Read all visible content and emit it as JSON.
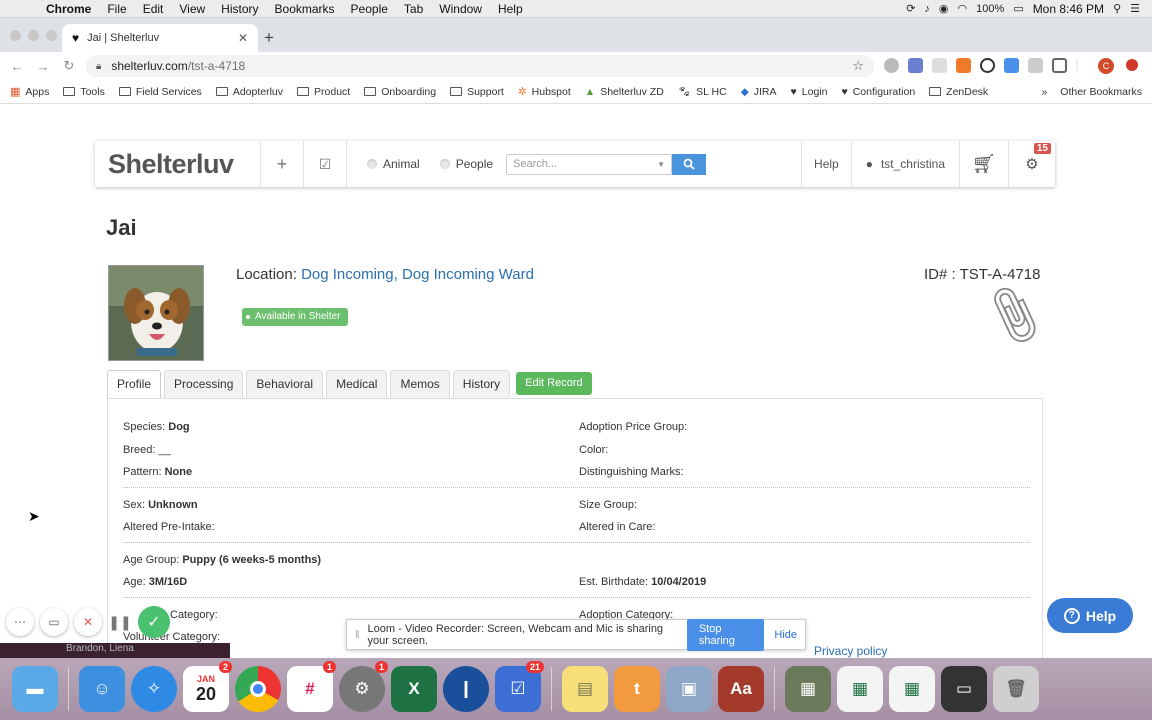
{
  "menubar": {
    "app": "Chrome",
    "items": [
      "File",
      "Edit",
      "View",
      "History",
      "Bookmarks",
      "People",
      "Tab",
      "Window",
      "Help"
    ],
    "battery": "100%",
    "clock": "Mon 8:46 PM"
  },
  "browser": {
    "tab_title": "Jai | Shelterluv",
    "url_host": "shelterluv.com",
    "url_path": "/tst-a-4718",
    "bookmarks": [
      "Apps",
      "Tools",
      "Field Services",
      "Adopterluv",
      "Product",
      "Onboarding",
      "Support",
      "Hubspot",
      "Shelterluv ZD",
      "SL HC",
      "JIRA",
      "Login",
      "Configuration",
      "ZenDesk"
    ],
    "bookmarks_more": "»",
    "other_bookmarks": "Other Bookmarks",
    "profile_initial": "C"
  },
  "header": {
    "logo": "Shelterluv",
    "radio_animal": "Animal",
    "radio_people": "People",
    "search_placeholder": "Search...",
    "help": "Help",
    "user": "tst_christina",
    "notifications": "15"
  },
  "animal": {
    "name": "Jai",
    "location_label": "Location:",
    "location_value": "Dog Incoming, Dog Incoming Ward",
    "id": "ID# : TST-A-4718",
    "status": "Available in Shelter"
  },
  "tabs": [
    "Profile",
    "Processing",
    "Behavioral",
    "Medical",
    "Memos",
    "History"
  ],
  "edit_button": "Edit Record",
  "profile": {
    "species_label": "Species:",
    "species": "Dog",
    "breed_label": "Breed:",
    "breed": "__",
    "pattern_label": "Pattern:",
    "pattern": "None",
    "adoption_price_label": "Adoption Price Group:",
    "color_label": "Color:",
    "marks_label": "Distinguishing Marks:",
    "sex_label": "Sex:",
    "sex": "Unknown",
    "altered_pre_label": "Altered Pre-Intake:",
    "size_label": "Size Group:",
    "altered_care_label": "Altered in Care:",
    "age_group_label": "Age Group:",
    "age_group": "Puppy (6 weeks-5 months)",
    "age_label": "Age:",
    "age": "3M/16D",
    "birthdate_label": "Est. Birthdate:",
    "birthdate": "10/04/2019",
    "foster_label": "Category:",
    "adoption_cat_label": "Adoption Category:",
    "volunteer_label": "Volunteer Category:"
  },
  "loom": {
    "message": "Loom - Video Recorder: Screen, Webcam and Mic is sharing your screen.",
    "stop": "Stop sharing",
    "hide": "Hide"
  },
  "help_widget": "Help",
  "privacy": "Privacy policy",
  "bottom_name": "Brandon, Liena",
  "dock": {
    "calendar_month": "JAN",
    "calendar_day": "20",
    "calendar_badge": "2",
    "slack_badge": "1",
    "prefs_badge": "1",
    "tasks_badge": "21"
  }
}
